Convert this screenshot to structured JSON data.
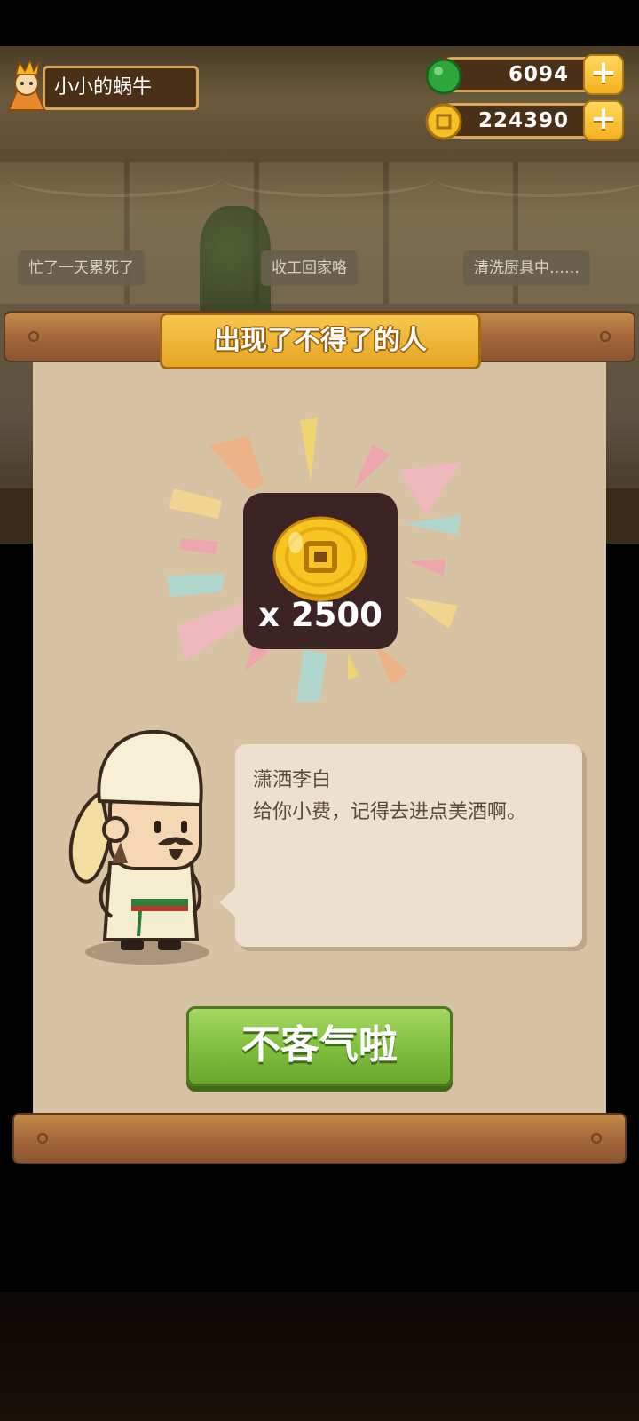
{
  "player": {
    "name": "小小的蜗牛"
  },
  "resources": [
    {
      "id": "jade",
      "value": "6094",
      "icon": "green-jade-icon",
      "color": "#2ea63a"
    },
    {
      "id": "coin",
      "value": "224390",
      "icon": "gold-coin-icon",
      "color": "#f5c023"
    }
  ],
  "plus_label": "+",
  "scene": {
    "speech": [
      "忙了一天累死了",
      "收工回家咯",
      "清洗厨具中……"
    ]
  },
  "dialog": {
    "title": "出现了不得了的人",
    "reward": {
      "icon": "gold-coin-icon",
      "amount": "x 2500"
    },
    "speaker": "潇洒李白",
    "message": "给你小费，记得去进点美酒啊。",
    "confirm_label": "不客气啦"
  },
  "colors": {
    "banner": "#f0b73a",
    "button": "#7fbd3d",
    "parchment": "#d8c2a4",
    "wood": "#a5683a"
  }
}
